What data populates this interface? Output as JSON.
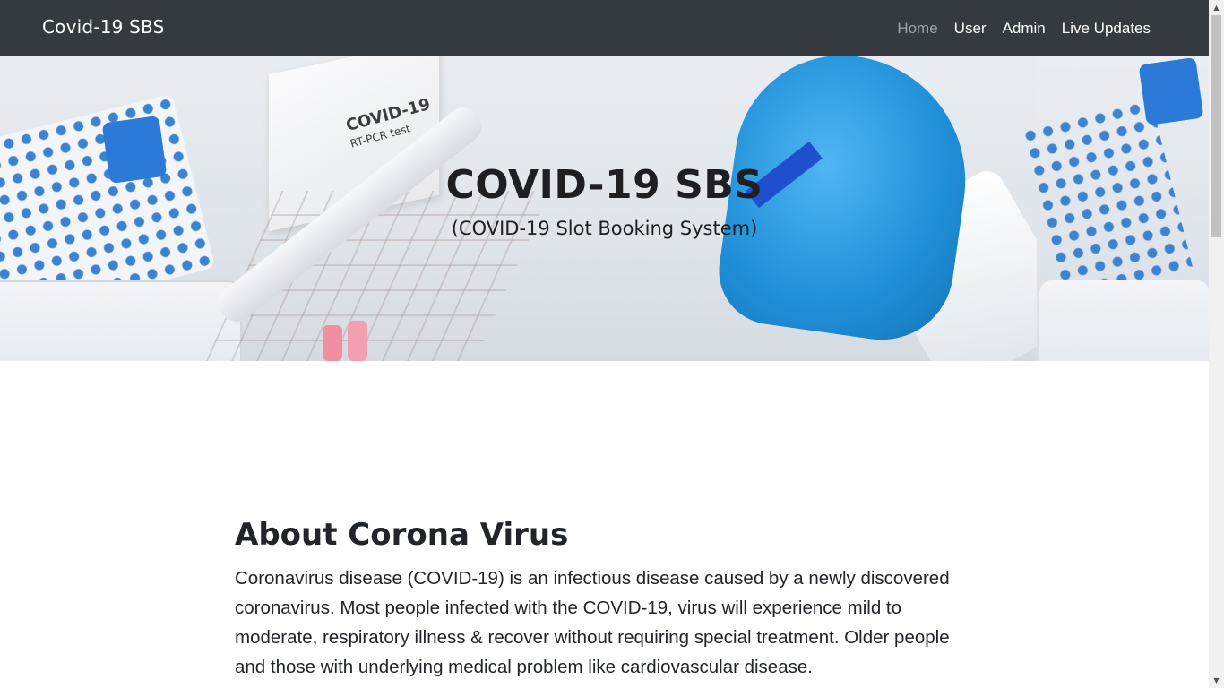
{
  "navbar": {
    "brand": "Covid-19 SBS",
    "links": [
      {
        "label": "Home",
        "active": true
      },
      {
        "label": "User",
        "active": false
      },
      {
        "label": "Admin",
        "active": false
      },
      {
        "label": "Live Updates",
        "active": false
      }
    ],
    "background_color": "#343a40"
  },
  "hero": {
    "title": "COVID-19 SBS",
    "subtitle": "(COVID-19 Slot Booking System)",
    "image_box_text": "COVID-19",
    "image_box_subtext": "RT-PCR test"
  },
  "about": {
    "heading": "About Corona Virus",
    "text": "Coronavirus disease (COVID-19) is an infectious disease caused by a newly discovered coronavirus. Most people infected with the COVID-19, virus will experience mild to moderate, respiratory illness & recover without requiring special treatment. Older people and those with underlying medical problem like cardiovascular disease."
  },
  "scrollbar": {
    "up_icon": "triangle-up-icon",
    "down_icon": "triangle-down-icon"
  }
}
